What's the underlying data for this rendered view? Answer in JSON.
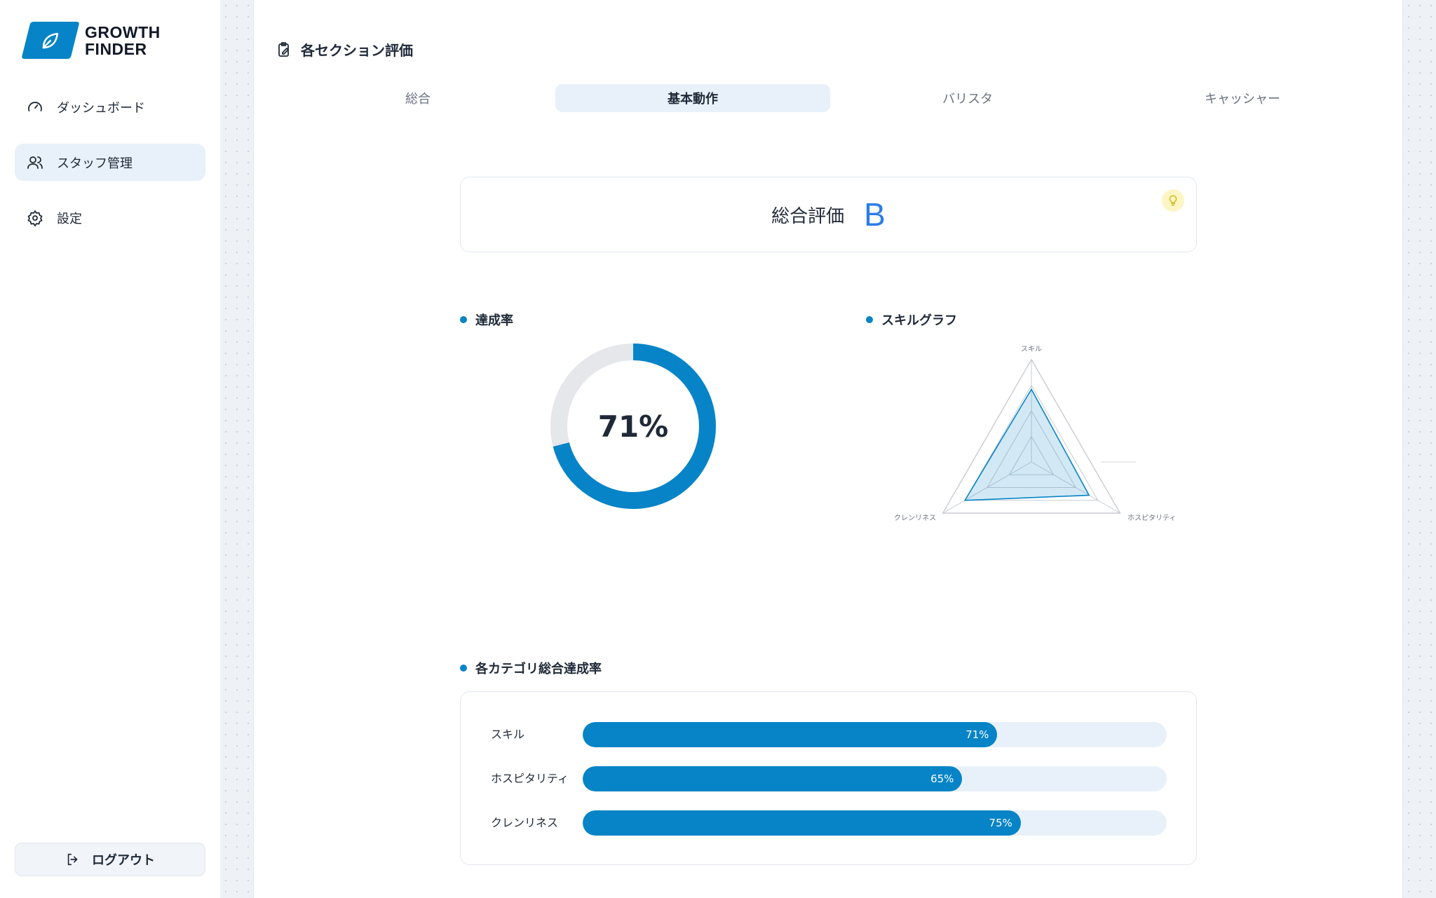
{
  "brand": {
    "line1": "GROWTH",
    "line2": "FINDER",
    "color": "#0784c7"
  },
  "sidebar": {
    "items": [
      {
        "label": "ダッシュボード",
        "icon": "gauge-icon",
        "active": false
      },
      {
        "label": "スタッフ管理",
        "icon": "users-icon",
        "active": true
      },
      {
        "label": "設定",
        "icon": "gear-icon",
        "active": false
      }
    ],
    "logout_label": "ログアウト"
  },
  "page": {
    "title": "各セクション評価",
    "tabs": [
      {
        "label": "総合",
        "active": false
      },
      {
        "label": "基本動作",
        "active": true
      },
      {
        "label": "バリスタ",
        "active": false
      },
      {
        "label": "キャッシャー",
        "active": false
      }
    ],
    "overall": {
      "label": "総合評価",
      "grade": "B"
    },
    "achievement": {
      "title": "達成率",
      "value": "71%",
      "fraction": 0.71
    },
    "skill_graph": {
      "title": "スキルグラフ",
      "axes": [
        "スキル",
        "ホスピタリティ",
        "クレンリネス"
      ],
      "values": [
        0.71,
        0.65,
        0.75
      ]
    },
    "categories": {
      "title": "各カテゴリ総合達成率",
      "rows": [
        {
          "label": "スキル",
          "value": 71,
          "display": "71%"
        },
        {
          "label": "ホスピタリティ",
          "value": 65,
          "display": "65%"
        },
        {
          "label": "クレンリネス",
          "value": 75,
          "display": "75%"
        }
      ]
    }
  },
  "colors": {
    "accent": "#0784c7",
    "grade": "#2b7de9",
    "track": "#e8f1f9"
  }
}
